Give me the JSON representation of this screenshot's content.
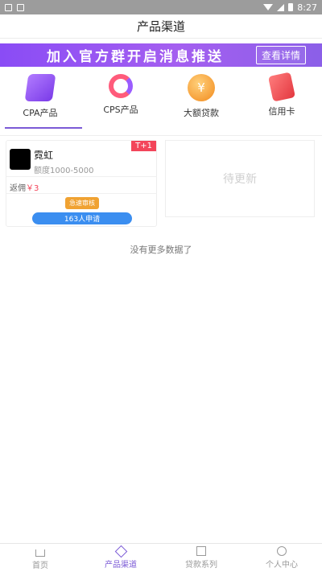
{
  "status_bar": {
    "time": "8:27"
  },
  "header": {
    "title": "产品渠道"
  },
  "banner": {
    "text": "加入官方群开启消息推送",
    "button": "查看详情"
  },
  "categories": [
    {
      "label": "CPA产品",
      "icon": "cpa-icon",
      "active": true
    },
    {
      "label": "CPS产品",
      "icon": "cps-icon",
      "active": false
    },
    {
      "label": "大额贷款",
      "icon": "large-loan-icon",
      "active": false
    },
    {
      "label": "信用卡",
      "icon": "credit-card-icon",
      "active": false
    }
  ],
  "product": {
    "tag": "T+1",
    "name": "霓虹",
    "limit": "额度1000-5000",
    "rebate_label": "返佣",
    "rebate_value": "￥3",
    "fast_badge": "急速审核",
    "apply_label": "163人申请"
  },
  "placeholder": {
    "text": "待更新"
  },
  "list_end": {
    "text": "没有更多数据了"
  },
  "tabbar": [
    {
      "label": "首页",
      "icon": "home-icon",
      "active": false
    },
    {
      "label": "产品渠道",
      "icon": "product-channel-icon",
      "active": true
    },
    {
      "label": "贷款系列",
      "icon": "loan-series-icon",
      "active": false
    },
    {
      "label": "个人中心",
      "icon": "user-center-icon",
      "active": false
    }
  ],
  "colors": {
    "accent": "#7b5ad6",
    "banner": "#8a4cf5",
    "tag": "#f3455a",
    "apply": "#3b8ef0",
    "fast": "#f0a232"
  }
}
